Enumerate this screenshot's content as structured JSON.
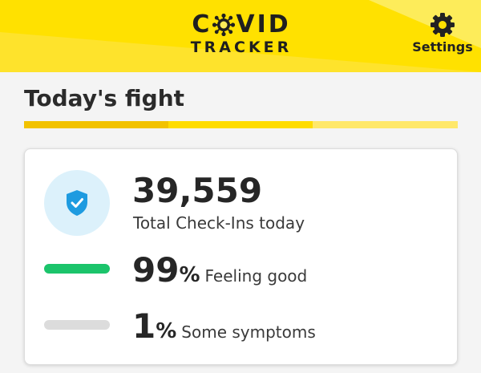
{
  "colors": {
    "header_yellow": "#fdec5a",
    "header_deep_yellow": "#ffe100",
    "progress_segment_1": "#f2c200",
    "progress_segment_2": "#ffdc00",
    "progress_segment_3": "#ffe86a",
    "good_green": "#1bc46b",
    "symptom_gray": "#dcdcdc",
    "shield_blue": "#1e9be0"
  },
  "header": {
    "logo_line1_left": "C",
    "logo_line1_right": "VID",
    "logo_line2": "TRACKER",
    "settings_label": "Settings",
    "settings_icon": "gear-icon"
  },
  "section": {
    "title": "Today's fight"
  },
  "card": {
    "checkins": {
      "value": "39,559",
      "label": "Total Check-Ins today",
      "icon": "shield-check-icon"
    },
    "feeling_good": {
      "percent": "99",
      "percent_sign": "%",
      "label": "Feeling good",
      "fraction": 0.99
    },
    "symptoms": {
      "percent": "1",
      "percent_sign": "%",
      "label": "Some symptoms",
      "fraction": 0.01
    }
  }
}
